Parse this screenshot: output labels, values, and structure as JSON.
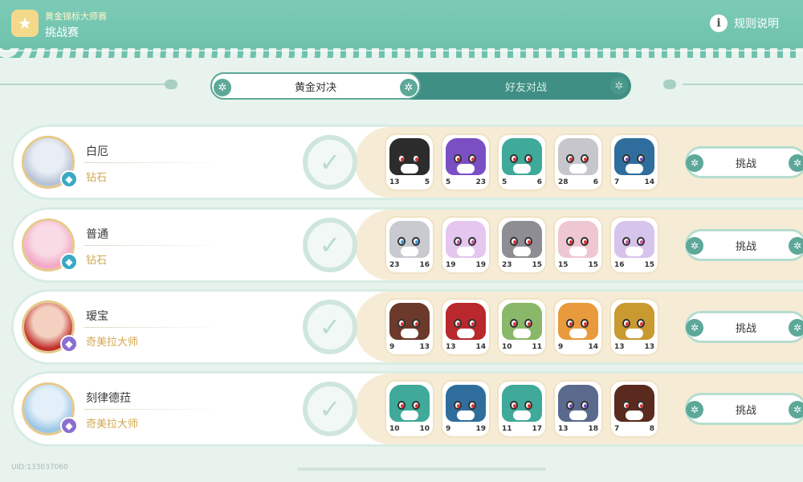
{
  "header": {
    "subtitle": "黄金锦标大师赛",
    "title": "挑战赛",
    "rules_label": "规则说明",
    "logo_icon": "trophy-icon",
    "info_icon": "info-icon"
  },
  "tabs": [
    {
      "label": "黄金对决",
      "active": true
    },
    {
      "label": "好友对战",
      "active": false
    }
  ],
  "players": [
    {
      "name": "白厄",
      "rank": "钻石",
      "badge_color": "#3aa9c4",
      "avatar_colors": [
        "#e9eef4",
        "#b7c2d6"
      ],
      "challenge_label": "挑战",
      "pets": [
        {
          "color": "#2c2c2c",
          "eye": "#d33",
          "left": "13",
          "right": "5"
        },
        {
          "color": "#7b4fc4",
          "eye": "#d33",
          "left": "5",
          "right": "23"
        },
        {
          "color": "#3fa99a",
          "eye": "#d33",
          "left": "5",
          "right": "6"
        },
        {
          "color": "#c6c6cc",
          "eye": "#d33",
          "left": "28",
          "right": "6"
        },
        {
          "color": "#2f6e9c",
          "eye": "#6a4fc4",
          "left": "7",
          "right": "14"
        }
      ]
    },
    {
      "name": "普通",
      "rank": "钻石",
      "badge_color": "#3aa9c4",
      "avatar_colors": [
        "#f9dbe6",
        "#f2a8c6"
      ],
      "challenge_label": "挑战",
      "pets": [
        {
          "color": "#c9c9d0",
          "eye": "#3a9ad9",
          "left": "23",
          "right": "16"
        },
        {
          "color": "#e4c6ef",
          "eye": "#c44fa8",
          "left": "19",
          "right": "19"
        },
        {
          "color": "#8d8d93",
          "eye": "#d33",
          "left": "23",
          "right": "15"
        },
        {
          "color": "#efc7d3",
          "eye": "#d33",
          "left": "15",
          "right": "15"
        },
        {
          "color": "#d7c4ec",
          "eye": "#c44fa8",
          "left": "16",
          "right": "15"
        }
      ]
    },
    {
      "name": "瑷宝",
      "rank": "奇美拉大师",
      "badge_color": "#8b6fd0",
      "avatar_colors": [
        "#f3d0c0",
        "#c0302c"
      ],
      "challenge_label": "挑战",
      "pets": [
        {
          "color": "#6b3a2a",
          "eye": "#d33",
          "left": "9",
          "right": "13"
        },
        {
          "color": "#b8282c",
          "eye": "#d33",
          "left": "13",
          "right": "14"
        },
        {
          "color": "#8ab86a",
          "eye": "#d33",
          "left": "10",
          "right": "11"
        },
        {
          "color": "#e89a3c",
          "eye": "#d33",
          "left": "9",
          "right": "14"
        },
        {
          "color": "#c89a30",
          "eye": "#d33",
          "left": "13",
          "right": "13"
        }
      ]
    },
    {
      "name": "刻律德菈",
      "rank": "奇美拉大师",
      "badge_color": "#8b6fd0",
      "avatar_colors": [
        "#e3f0fa",
        "#9cc6e6"
      ],
      "challenge_label": "挑战",
      "pets": [
        {
          "color": "#3fa99a",
          "eye": "#d33",
          "left": "10",
          "right": "10"
        },
        {
          "color": "#2f6e9c",
          "eye": "#d33",
          "left": "9",
          "right": "19"
        },
        {
          "color": "#3fa99a",
          "eye": "#d33",
          "left": "11",
          "right": "17"
        },
        {
          "color": "#5a6a8c",
          "eye": "#6a4fc4",
          "left": "13",
          "right": "18"
        },
        {
          "color": "#5a2a1e",
          "eye": "#d33",
          "left": "7",
          "right": "8"
        }
      ]
    }
  ],
  "footer": {
    "uid": "UID:133037060"
  }
}
